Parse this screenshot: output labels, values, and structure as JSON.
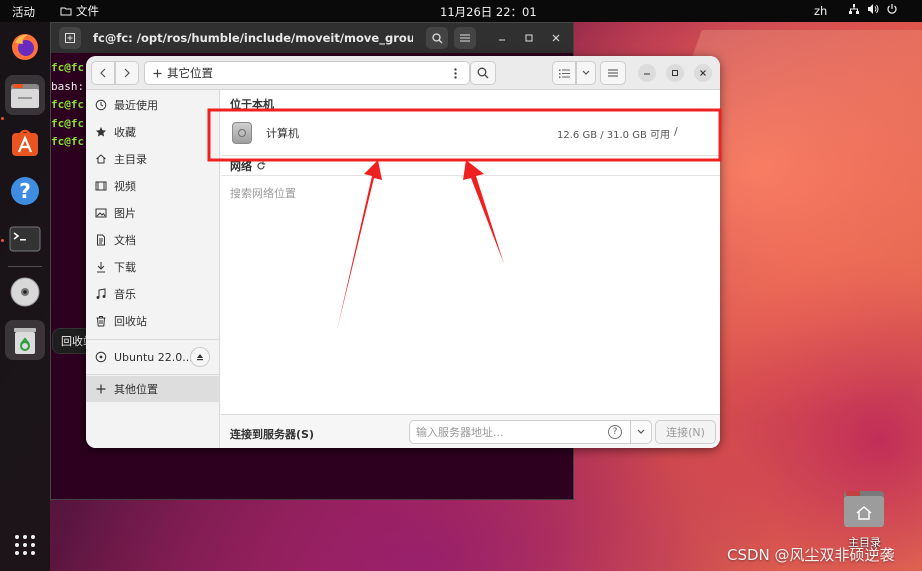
{
  "topbar": {
    "activities": "活动",
    "app_menu": "文件",
    "clock": "11月26日  22：01",
    "lang": "zh"
  },
  "dock": {
    "tooltip": "回收站"
  },
  "terminal": {
    "title": "fc@fc: /opt/ros/humble/include/moveit/move_group_interf...",
    "lines": [
      "fc@fc",
      "bash:",
      "fc@fc",
      "fc@fc",
      "fc@fc"
    ]
  },
  "file_manager": {
    "path": "其它位置",
    "sidebar": {
      "items": [
        {
          "label": "最近使用",
          "icon": "clock-icon"
        },
        {
          "label": "收藏",
          "icon": "star-icon"
        },
        {
          "label": "主目录",
          "icon": "home-icon"
        },
        {
          "label": "视频",
          "icon": "video-icon"
        },
        {
          "label": "图片",
          "icon": "image-icon"
        },
        {
          "label": "文档",
          "icon": "document-icon"
        },
        {
          "label": "下载",
          "icon": "download-icon"
        },
        {
          "label": "音乐",
          "icon": "music-icon"
        },
        {
          "label": "回收站",
          "icon": "trash-icon"
        }
      ],
      "volume": "Ubuntu 22.0...",
      "other_locations": "其他位置"
    },
    "main": {
      "on_this_computer": "位于本机",
      "computer": {
        "name": "计算机",
        "usage": "12.6 GB / 31.0 GB 可用",
        "mount": "/"
      },
      "network": "网络",
      "network_placeholder": "搜索网络位置"
    },
    "connect": {
      "label": "连接到服务器(S)",
      "placeholder": "输入服务器地址...",
      "button": "连接(N)"
    }
  },
  "desktop": {
    "home_label": "主目录"
  },
  "watermark": "CSDN @风尘双非硕逆袭",
  "colors": {
    "annotation_red": "#f02020",
    "ubuntu_orange": "#e95420",
    "terminal_bg": "#2c001e",
    "prompt_green": "#8ae234"
  }
}
